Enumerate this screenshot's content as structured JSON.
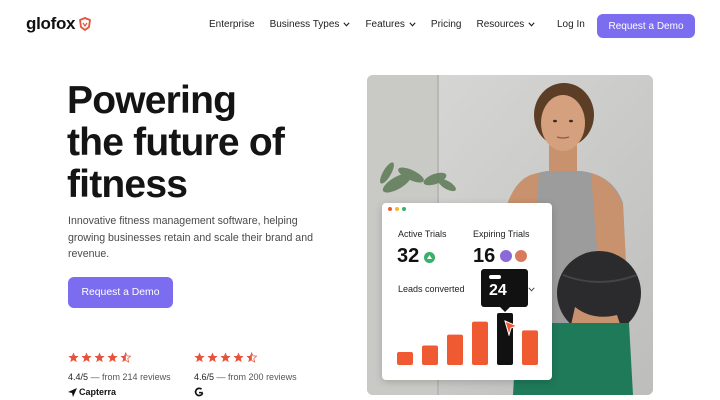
{
  "nav": {
    "logo": "glofox",
    "links": [
      {
        "label": "Enterprise",
        "dropdown": false
      },
      {
        "label": "Business Types",
        "dropdown": true
      },
      {
        "label": "Features",
        "dropdown": true
      },
      {
        "label": "Pricing",
        "dropdown": false
      },
      {
        "label": "Resources",
        "dropdown": true
      }
    ],
    "login": "Log In",
    "cta": "Request a Demo"
  },
  "hero": {
    "title_line1": "Powering",
    "title_line2": "the future of",
    "title_line3": "fitness",
    "subtitle": "Innovative fitness management software, helping growing businesses retain and scale their brand and revenue.",
    "cta": "Request a Demo"
  },
  "ratings": [
    {
      "stars": 4.5,
      "score": "4.4/5",
      "from": "— from 214 reviews",
      "brand": "Capterra"
    },
    {
      "stars": 4.5,
      "score": "4.6/5",
      "from": "— from 200 reviews",
      "brand": ""
    }
  ],
  "card": {
    "active_trials_label": "Active Trials",
    "active_trials_value": "32",
    "expiring_trials_label": "Expiring Trials",
    "expiring_trials_value": "16",
    "leads_label": "Leads converted",
    "tooltip_value": "24",
    "bar_values": [
      6,
      9,
      14,
      20,
      24,
      16
    ],
    "highlight_index": 4
  },
  "colors": {
    "accent": "#7b6cf0",
    "star": "#e5533d",
    "bar": "#f05a32",
    "bar_highlight": "#111111",
    "up": "#3bb06a"
  }
}
